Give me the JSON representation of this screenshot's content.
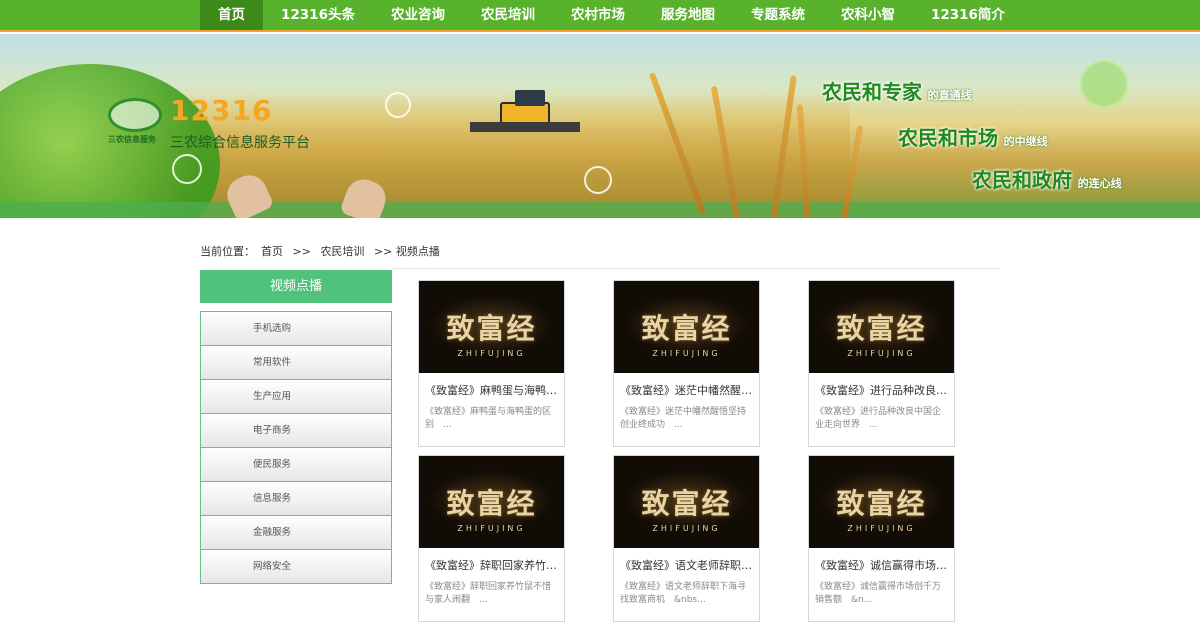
{
  "nav": {
    "items": [
      "首页",
      "12316头条",
      "农业咨询",
      "农民培训",
      "农村市场",
      "服务地图",
      "专题系统",
      "农科小智",
      "12316简介"
    ],
    "active_index": 0
  },
  "banner": {
    "logo_number": "12316",
    "logo_badge_text": "三农信息服务",
    "platform_name": "三农综合信息服务平台",
    "slogans": [
      {
        "big": "农民和专家",
        "small": "的直通线"
      },
      {
        "big": "农民和市场",
        "small": "的中继线"
      },
      {
        "big": "农民和政府",
        "small": "的连心线"
      }
    ]
  },
  "breadcrumb": {
    "prefix": "当前位置：",
    "home": "首页",
    "sep": ">>",
    "level1": "农民培训",
    "level2": "视频点播"
  },
  "sidebar": {
    "header": "视频点播",
    "items": [
      "手机选购",
      "常用软件",
      "生产应用",
      "电子商务",
      "便民服务",
      "信息服务",
      "金融服务",
      "网络安全"
    ]
  },
  "videos": [
    {
      "thumb_title": "致富经",
      "thumb_pinyin": "ZHIFUJING",
      "title": "《致富经》麻鸭蛋与海鸭蛋...",
      "desc": "《致富经》麻鸭蛋与海鸭蛋的区别　..."
    },
    {
      "thumb_title": "致富经",
      "thumb_pinyin": "ZHIFUJING",
      "title": "《致富经》迷茫中幡然醒悟...",
      "desc": "《致富经》迷茫中幡然醒悟坚持创业终成功　..."
    },
    {
      "thumb_title": "致富经",
      "thumb_pinyin": "ZHIFUJING",
      "title": "《致富经》进行品种改良中...",
      "desc": "《致富经》进行品种改良中国企业走向世界　..."
    },
    {
      "thumb_title": "致富经",
      "thumb_pinyin": "ZHIFUJING",
      "title": "《致富经》辞职回家养竹鼠...",
      "desc": "《致富经》辞职回家养竹鼠不惜与家人闹翻　..."
    },
    {
      "thumb_title": "致富经",
      "thumb_pinyin": "ZHIFUJING",
      "title": "《致富经》语文老师辞职下...",
      "desc": "《致富经》语文老师辞职下海寻找致富商机　&nbs..."
    },
    {
      "thumb_title": "致富经",
      "thumb_pinyin": "ZHIFUJING",
      "title": "《致富经》诚信赢得市场创...",
      "desc": "《致富经》诚信赢得市场创千万销售额　&n..."
    }
  ]
}
